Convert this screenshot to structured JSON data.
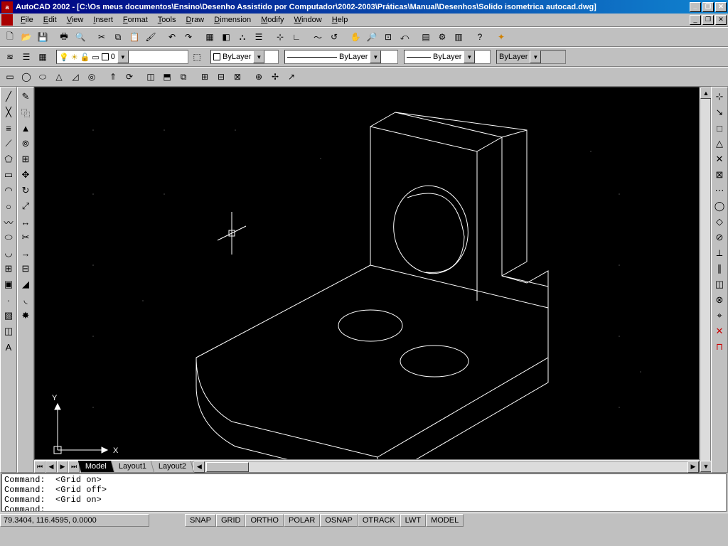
{
  "title": "AutoCAD 2002 - [C:\\Os meus documentos\\Ensino\\Desenho Assistido por Computador\\2002-2003\\Práticas\\Manual\\Desenhos\\Solido isometrica autocad.dwg]",
  "menubar": [
    "File",
    "Edit",
    "View",
    "Insert",
    "Format",
    "Tools",
    "Draw",
    "Dimension",
    "Modify",
    "Window",
    "Help"
  ],
  "layer_dropdown": "0",
  "props": {
    "color": "ByLayer",
    "linetype": "ByLayer",
    "lineweight": "ByLayer",
    "plotstyle": "ByLayer"
  },
  "tabs": {
    "active": "Model",
    "others": [
      "Layout1",
      "Layout2"
    ]
  },
  "command_lines": [
    "Command:  <Grid on>",
    "Command:  <Grid off>",
    "Command:  <Grid on>",
    "Command:"
  ],
  "status": {
    "coords": "79.3404, 116.4595, 0.0000",
    "toggles": [
      "SNAP",
      "GRID",
      "ORTHO",
      "POLAR",
      "OSNAP",
      "OTRACK",
      "LWT",
      "MODEL"
    ]
  },
  "ucs": {
    "x": "X",
    "y": "Y"
  }
}
